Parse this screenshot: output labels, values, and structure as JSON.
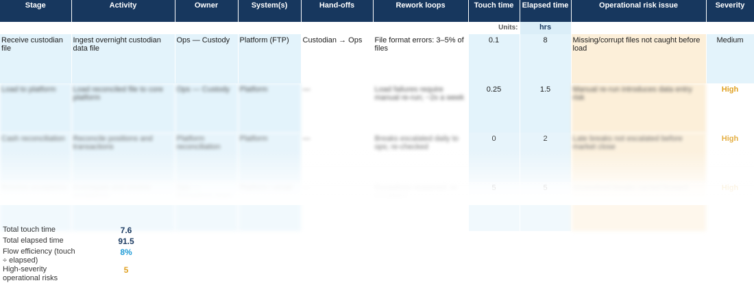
{
  "table": {
    "headers": [
      "Stage",
      "Activity",
      "Owner",
      "System(s)",
      "Hand-offs",
      "Rework loops",
      "Touch time",
      "Elapsed time",
      "Operational risk issue",
      "Severity"
    ],
    "units_label": "Units:",
    "units_value": "hrs",
    "rows": [
      {
        "stage": "Receive custodian file",
        "activity": "Ingest overnight custodian data file",
        "owner": "Ops — Custody",
        "systems": "Platform (FTP)",
        "handoffs": "Custodian → Ops",
        "rework": "File format errors: 3–5% of files",
        "touch": "0.1",
        "elapsed": "8",
        "risk": "Missing/corrupt files not caught before load",
        "severity": "Medium"
      },
      {
        "stage": "Load to platform",
        "activity": "Load reconciled file to core platform",
        "owner": "Ops — Custody",
        "systems": "Platform",
        "handoffs": "—",
        "rework": "Load failures require manual re-run; ~2x a week",
        "touch": "0.25",
        "elapsed": "1.5",
        "risk": "Manual re-run introduces data entry risk",
        "severity": "High"
      },
      {
        "stage": "Cash reconciliation",
        "activity": "Reconcile positions and transactions",
        "owner": "Platform reconciliation",
        "systems": "Platform",
        "handoffs": "—",
        "rework": "Breaks escalated daily to ops; re-checked",
        "touch": "0",
        "elapsed": "2",
        "risk": "Late breaks not escalated before market close",
        "severity": "High"
      },
      {
        "stage": "Resolve exceptions",
        "activity": "Investigate and resolve exceptions",
        "owner": "Ops — Exceptions team",
        "systems": "Platform / email",
        "handoffs": "—",
        "rework": "Exceptions reopened; re-escalated",
        "touch": "5",
        "elapsed": "5",
        "risk": "Unresolved breaks carried forward",
        "severity": "High"
      }
    ]
  },
  "summary": {
    "total_touch_label": "Total touch time",
    "total_touch_value": "7.6",
    "total_elapsed_label": "Total elapsed time",
    "total_elapsed_value": "91.5",
    "flow_eff_label": "Flow efficiency (touch ÷ elapsed)",
    "flow_eff_value": "8%",
    "high_sev_label": "High-severity operational risks",
    "high_sev_value": "5"
  },
  "colors": {
    "header_bg": "#17375e",
    "accent_blue": "#1f9bd6",
    "accent_orange": "#e0a020",
    "navy": "#17375e"
  }
}
